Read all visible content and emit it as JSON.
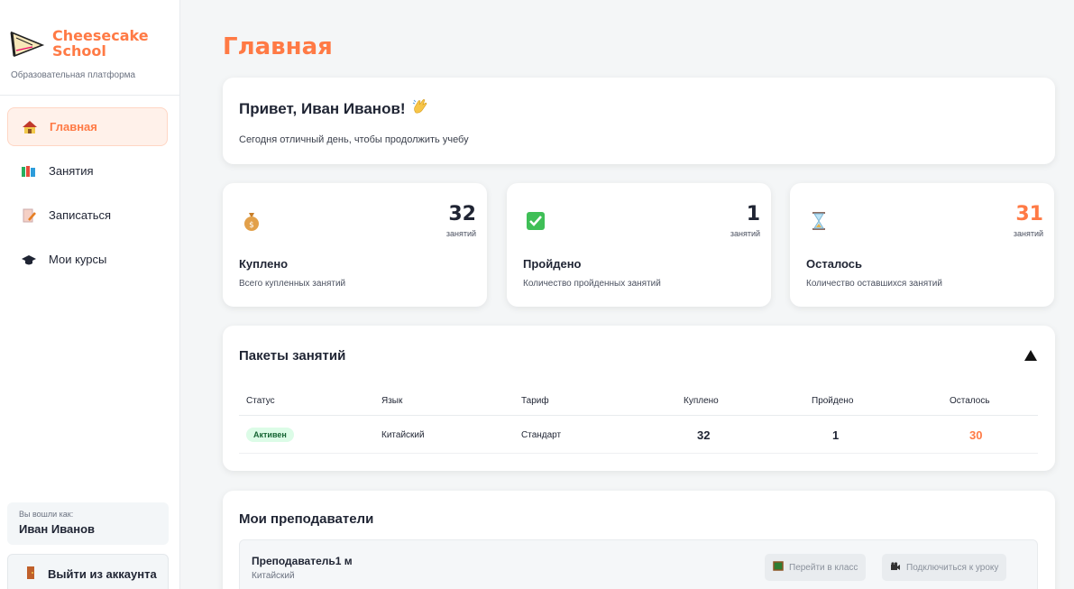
{
  "brand": {
    "name_line1": "Cheesecake",
    "name_line2": "School",
    "subtitle": "Образовательная платформа",
    "logo_icon": "cheesecake-slice-icon",
    "accent": "#ff7a45"
  },
  "nav": {
    "items": [
      {
        "label": "Главная",
        "icon": "house-icon",
        "active": true
      },
      {
        "label": "Занятия",
        "icon": "books-icon",
        "active": false
      },
      {
        "label": "Записаться",
        "icon": "document-pen-icon",
        "active": false
      },
      {
        "label": "Мои курсы",
        "icon": "graduation-cap-icon",
        "active": false
      }
    ]
  },
  "user": {
    "logged_in_label": "Вы вошли как:",
    "name": "Иван Иванов",
    "logout_label": "Выйти из аккаунта",
    "logout_icon": "door-icon"
  },
  "page": {
    "title": "Главная"
  },
  "greeting": {
    "title": "Привет, Иван Иванов!",
    "icon": "waving-hand-icon",
    "subtitle": "Сегодня отличный день, чтобы продолжить учебу"
  },
  "stats": [
    {
      "value": "32",
      "unit": "занятий",
      "title": "Куплено",
      "description": "Всего купленных занятий",
      "icon": "money-bag-icon",
      "color": "#1f2433"
    },
    {
      "value": "1",
      "unit": "занятий",
      "title": "Пройдено",
      "description": "Количество пройденных занятий",
      "icon": "check-box-icon",
      "color": "#1f2433"
    },
    {
      "value": "31",
      "unit": "занятий",
      "title": "Осталось",
      "description": "Количество оставшихся занятий",
      "icon": "hourglass-icon",
      "color": "#ff7a45"
    }
  ],
  "packages": {
    "title": "Пакеты занятий",
    "toggle_icon": "triangle-up-icon",
    "columns": [
      "Статус",
      "Язык",
      "Тариф",
      "Куплено",
      "Пройдено",
      "Осталось"
    ],
    "rows": [
      {
        "status": "Активен",
        "language": "Китайский",
        "tariff": "Стандарт",
        "bought": "32",
        "passed": "1",
        "left": "30"
      }
    ]
  },
  "teachers": {
    "title": "Мои преподаватели",
    "items": [
      {
        "name": "Преподаватель1 м",
        "language": "Китайский",
        "go_class_label": "Перейти в класс",
        "go_class_icon": "chalkboard-icon",
        "join_label": "Подключиться к уроку",
        "join_icon": "video-camera-icon"
      }
    ]
  }
}
